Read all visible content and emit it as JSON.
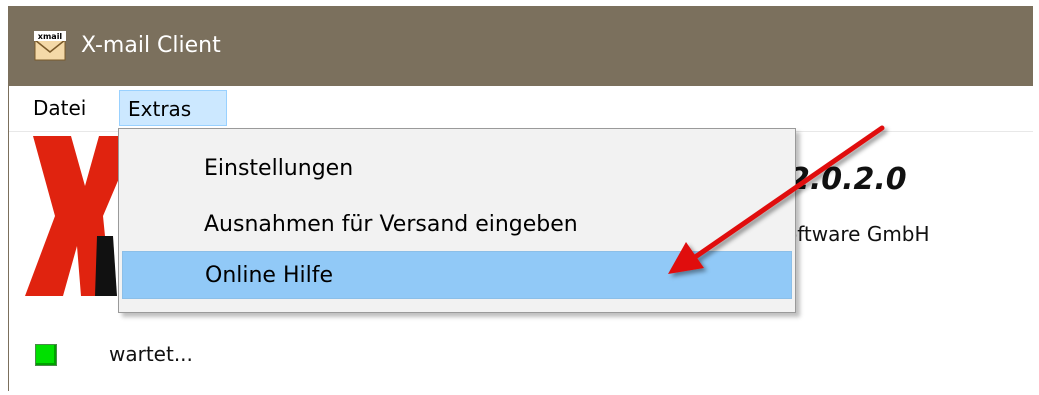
{
  "window": {
    "title": "X-mail Client"
  },
  "menubar": {
    "items": [
      "Datei",
      "Extras"
    ]
  },
  "dropdown": {
    "items": [
      "Einstellungen",
      "Ausnahmen für Versand eingeben",
      "Online Hilfe"
    ],
    "highlighted": "Online Hilfe"
  },
  "content": {
    "version_text": "2.0.2.0",
    "company_text": "oftware GmbH",
    "status_text": "wartet...",
    "status_color": "#00e000"
  },
  "colors": {
    "titlebar": "#7b705d",
    "menu_highlight": "#cce8ff",
    "dropdown_highlight": "#91c9f7",
    "logo": "#e0230f",
    "arrow": "#e01010"
  }
}
